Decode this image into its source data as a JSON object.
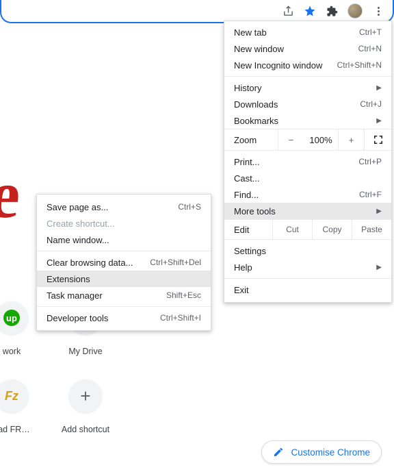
{
  "toolbar": {
    "icons": [
      "share-icon",
      "star-icon",
      "extensions-icon",
      "avatar",
      "kebab-menu"
    ]
  },
  "main_menu": {
    "items_top": [
      {
        "label": "New tab",
        "shortcut": "Ctrl+T"
      },
      {
        "label": "New window",
        "shortcut": "Ctrl+N"
      },
      {
        "label": "New Incognito window",
        "shortcut": "Ctrl+Shift+N"
      }
    ],
    "history": {
      "label": "History"
    },
    "downloads": {
      "label": "Downloads",
      "shortcut": "Ctrl+J"
    },
    "bookmarks": {
      "label": "Bookmarks"
    },
    "zoom": {
      "label": "Zoom",
      "minus": "−",
      "value": "100%",
      "plus": "+"
    },
    "print": {
      "label": "Print...",
      "shortcut": "Ctrl+P"
    },
    "cast": {
      "label": "Cast..."
    },
    "find": {
      "label": "Find...",
      "shortcut": "Ctrl+F"
    },
    "more_tools": {
      "label": "More tools"
    },
    "edit": {
      "label": "Edit",
      "cut": "Cut",
      "copy": "Copy",
      "paste": "Paste"
    },
    "settings": {
      "label": "Settings"
    },
    "help": {
      "label": "Help"
    },
    "exit": {
      "label": "Exit"
    }
  },
  "sub_menu": {
    "save_page": {
      "label": "Save page as...",
      "shortcut": "Ctrl+S"
    },
    "create_shortcut": {
      "label": "Create shortcut..."
    },
    "name_window": {
      "label": "Name window..."
    },
    "clear_data": {
      "label": "Clear browsing data...",
      "shortcut": "Ctrl+Shift+Del"
    },
    "extensions": {
      "label": "Extensions"
    },
    "task_manager": {
      "label": "Task manager",
      "shortcut": "Shift+Esc"
    },
    "dev_tools": {
      "label": "Developer tools",
      "shortcut": "Ctrl+Shift+I"
    }
  },
  "shortcuts_row1": [
    {
      "label": "work"
    },
    {
      "label": "My Drive"
    }
  ],
  "shortcuts_row2": [
    {
      "label": "oad FR…"
    },
    {
      "label": "Add shortcut"
    }
  ],
  "customize": {
    "label": "Customise Chrome"
  },
  "logo": "e"
}
